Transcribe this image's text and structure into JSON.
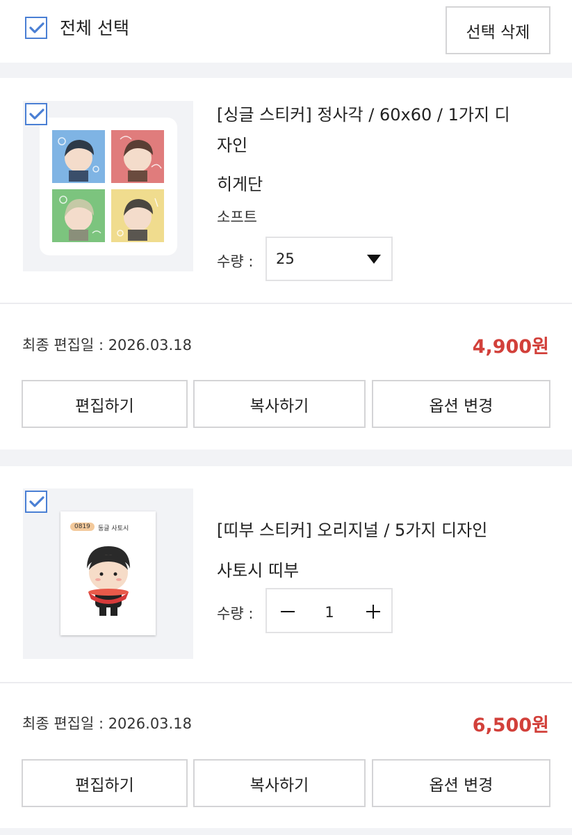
{
  "header": {
    "select_all_label": "전체 선택",
    "delete_selected_label": "선택 삭제"
  },
  "items": [
    {
      "title_line1": "[싱글 스티커] 정사각 / 60x60 / 1가지 디",
      "title_line2": "자인",
      "subtitle": "히게단",
      "option": "소프트",
      "quantity_label": "수량 :",
      "quantity_value": "25",
      "date_label": "최종 편집일 : 2026.03.18",
      "price": "4,900원",
      "buttons": {
        "edit": "편집하기",
        "copy": "복사하기",
        "change_option": "옵션 변경"
      }
    },
    {
      "title_line1": "[띠부 스티커] 오리지널 / 5가지 디자인",
      "subtitle": "사토시 띠부",
      "quantity_label": "수량 :",
      "quantity_value": "1",
      "thumb_badge": "0819",
      "thumb_caption": "동글 사토시",
      "date_label": "최종 편집일 : 2026.03.18",
      "price": "6,500원",
      "buttons": {
        "edit": "편집하기",
        "copy": "복사하기",
        "change_option": "옵션 변경"
      }
    }
  ],
  "colors": {
    "accent_blue": "#4a7fd4",
    "price_red": "#d2403a",
    "band_gray": "#f2f3f6",
    "tile_blue": "#7fb4e4",
    "tile_red": "#e07c7c",
    "tile_green": "#7cc47e",
    "tile_yellow": "#f0dc8e"
  },
  "icons": [
    "checkmark-icon",
    "dropdown-arrow-icon",
    "minus-icon",
    "plus-icon"
  ]
}
